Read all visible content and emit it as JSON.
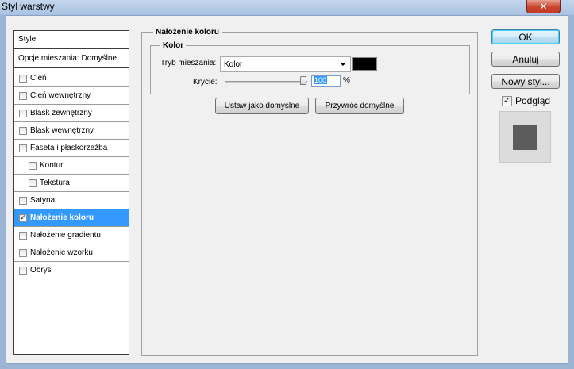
{
  "window": {
    "title": "Styl warstwy",
    "close_label": "✕"
  },
  "list": {
    "header": "Style",
    "blend_options": "Opcje mieszania: Domyślne",
    "items": [
      {
        "label": "Cień",
        "checked": false,
        "indent": false
      },
      {
        "label": "Cień wewnętrzny",
        "checked": false,
        "indent": false
      },
      {
        "label": "Blask zewnętrzny",
        "checked": false,
        "indent": false
      },
      {
        "label": "Blask wewnętrzny",
        "checked": false,
        "indent": false
      },
      {
        "label": "Faseta i płaskorzeźba",
        "checked": false,
        "indent": false
      },
      {
        "label": "Kontur",
        "checked": false,
        "indent": true
      },
      {
        "label": "Tekstura",
        "checked": false,
        "indent": true
      },
      {
        "label": "Satyna",
        "checked": false,
        "indent": false
      },
      {
        "label": "Nałożenie koloru",
        "checked": true,
        "indent": false,
        "selected": true
      },
      {
        "label": "Nałożenie gradientu",
        "checked": false,
        "indent": false
      },
      {
        "label": "Nałożenie wzorku",
        "checked": false,
        "indent": false
      },
      {
        "label": "Obrys",
        "checked": false,
        "indent": false
      }
    ]
  },
  "panel": {
    "title": "Nałożenie koloru",
    "group_title": "Kolor",
    "blend_mode_label": "Tryb mieszania:",
    "blend_mode_value": "Kolor",
    "color": "#000000",
    "opacity_label": "Krycie:",
    "opacity_value": "100",
    "opacity_unit": "%",
    "set_default_label": "Ustaw jako domyślne",
    "reset_default_label": "Przywróć domyślne"
  },
  "actions": {
    "ok_label": "OK",
    "cancel_label": "Anuluj",
    "new_style_label": "Nowy styl...",
    "preview_label": "Podgląd",
    "preview_checked": true,
    "preview_color": "#5c5c5c"
  }
}
